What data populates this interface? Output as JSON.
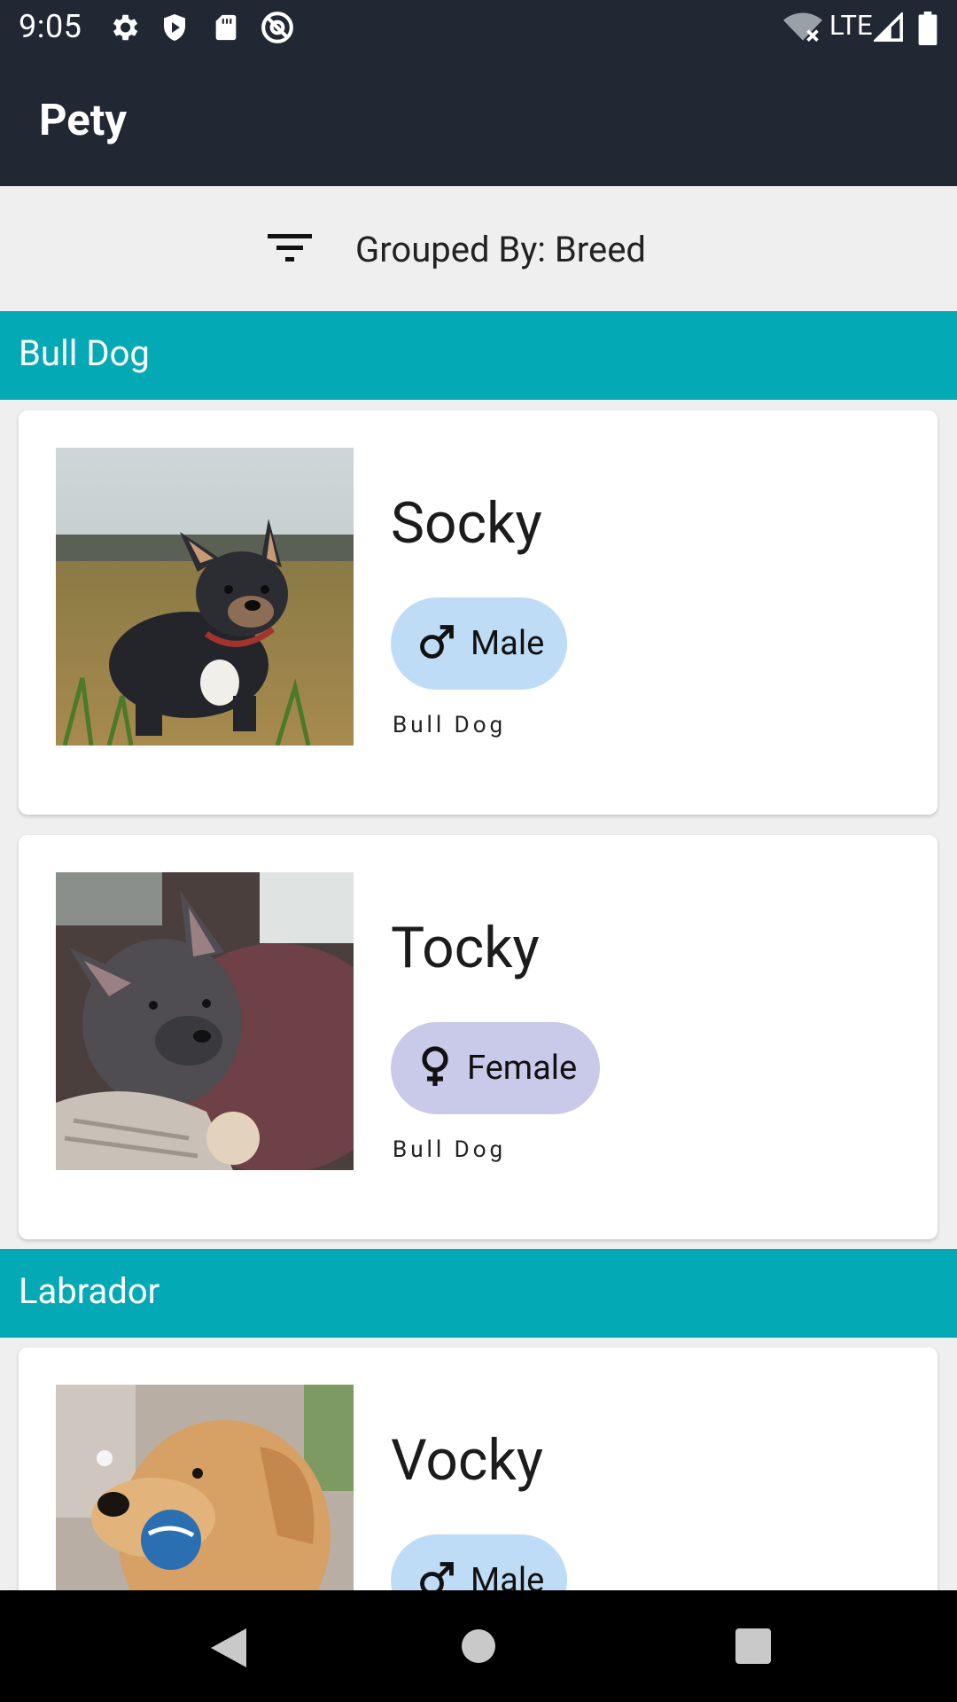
{
  "status_bar": {
    "time": "9:05",
    "lte": "LTE",
    "icons": [
      "settings-icon",
      "shield-icon",
      "sd-card-icon",
      "at-sign-icon",
      "wifi-icon",
      "signal-icon",
      "battery-icon"
    ]
  },
  "app_bar": {
    "title": "Pety"
  },
  "grouping": {
    "label": "Grouped By: Breed",
    "icon": "filter-icon"
  },
  "sections": [
    {
      "title": "Bull Dog",
      "pets": [
        {
          "name": "Socky",
          "gender": "Male",
          "breed": "Bull Dog",
          "gender_color": "#bedcf6"
        },
        {
          "name": "Tocky",
          "gender": "Female",
          "breed": "Bull Dog",
          "gender_color": "#c9c9ea"
        }
      ]
    },
    {
      "title": "Labrador",
      "pets": [
        {
          "name": "Vocky",
          "gender": "Male",
          "breed": "",
          "gender_color": "#bedcf6"
        }
      ]
    }
  ],
  "colors": {
    "app_bar": "#212733",
    "section_header": "#03aab5",
    "male_chip": "#bedcf6",
    "female_chip": "#c9c9ea"
  },
  "nav_bar": {
    "icons": [
      "back-icon",
      "home-icon",
      "recents-icon"
    ]
  }
}
